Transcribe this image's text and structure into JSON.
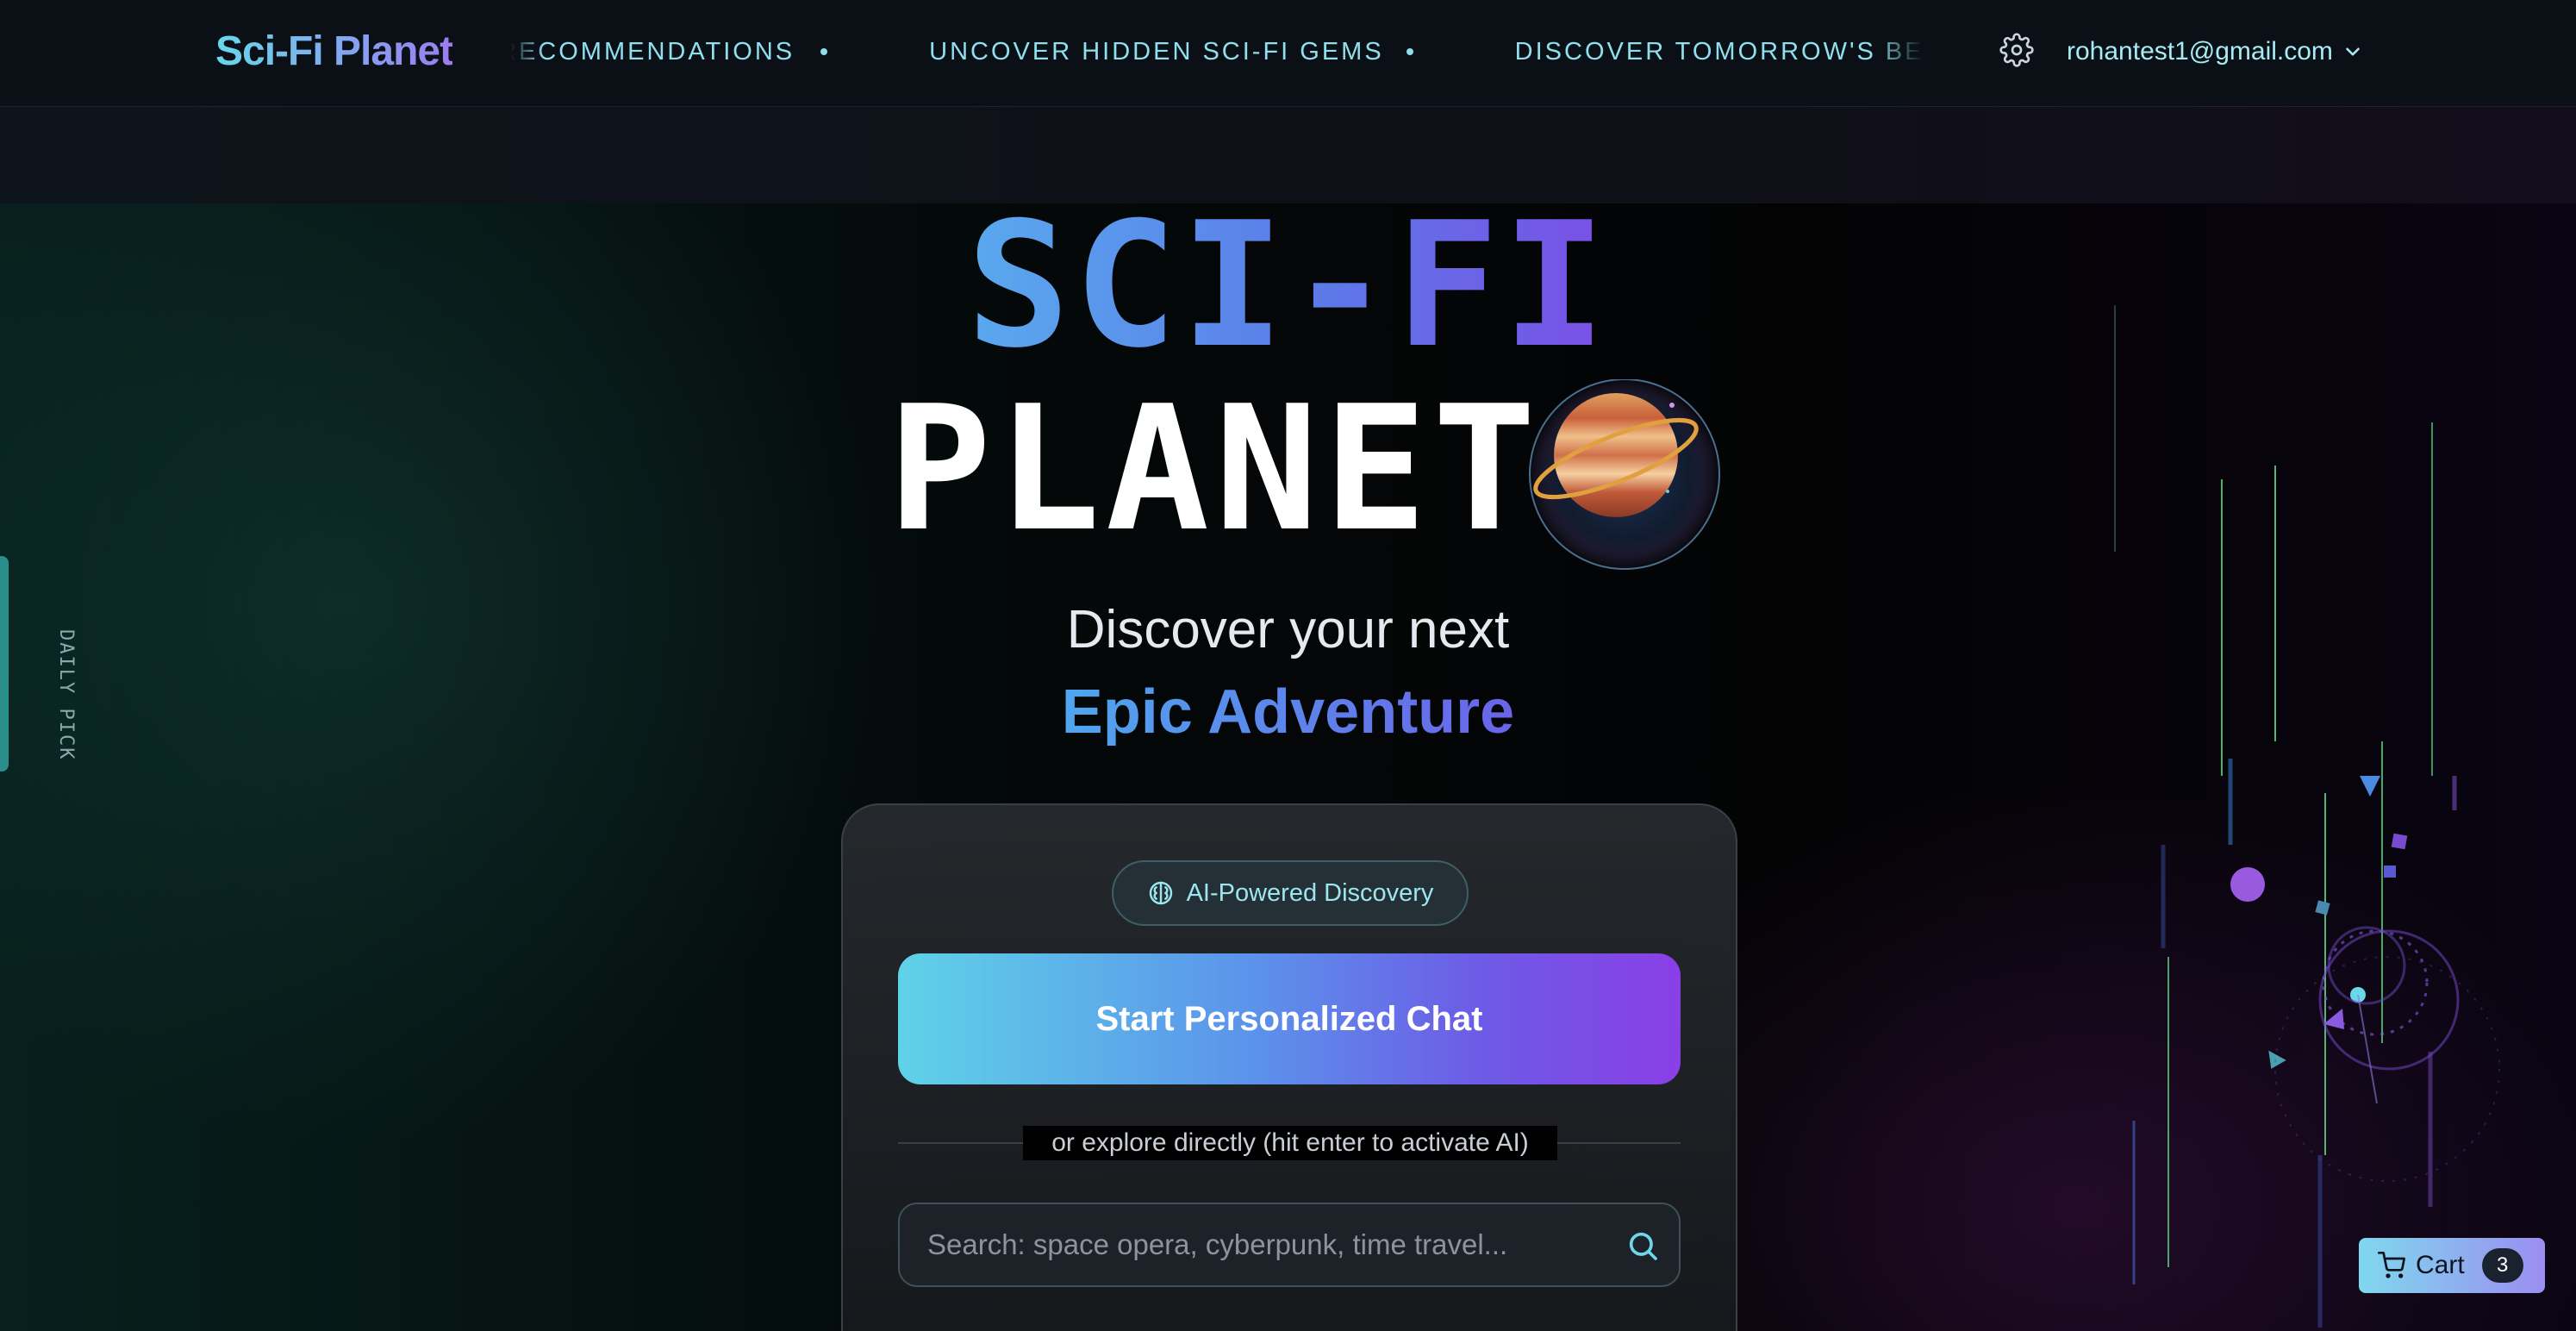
{
  "header": {
    "brand": "Sci-Fi Planet",
    "ticker": [
      "RECOMMENDATIONS",
      "UNCOVER HIDDEN SCI-FI GEMS",
      "DISCOVER TOMORROW'S BEST"
    ],
    "settings_icon": "gear-icon",
    "user_email": "rohantest1@gmail.com",
    "user_menu_icon": "chevron-down-icon"
  },
  "sidebar": {
    "daily_pick_label": "DAILY PICK"
  },
  "hero": {
    "title_line1": "SCI-FI",
    "title_line2": "PLANET",
    "planet_icon": "planet-icon",
    "tagline_line1": "Discover your next",
    "tagline_line2": "Epic Adventure"
  },
  "discovery": {
    "badge_label": "AI-Powered Discovery",
    "badge_icon": "brain-icon",
    "chat_button_label": "Start Personalized Chat",
    "divider_text": "or explore directly (hit enter to activate AI)",
    "search_placeholder": "Search: space opera, cyberpunk, time travel...",
    "search_value": "",
    "search_icon": "search-icon"
  },
  "cart": {
    "label": "Cart",
    "count": "3",
    "icon": "cart-icon"
  },
  "colors": {
    "accent_cyan": "#67d8ea",
    "accent_blue": "#5b7ae8",
    "accent_purple": "#8a3fe6",
    "background": "#050708"
  }
}
